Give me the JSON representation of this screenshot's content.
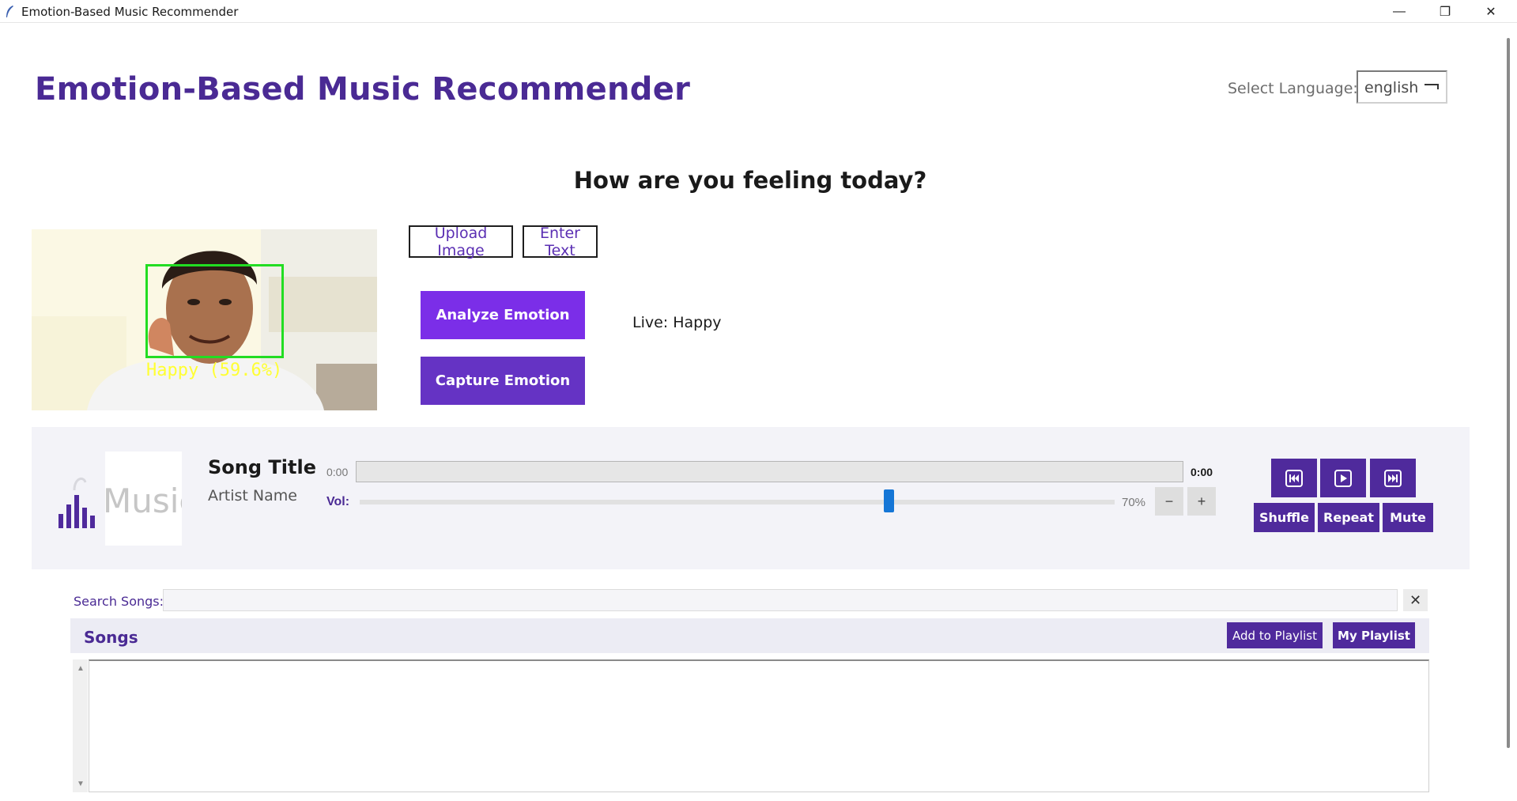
{
  "window": {
    "title": "Emotion-Based Music Recommender",
    "minimize": "—",
    "maximize": "❐",
    "close": "✕"
  },
  "header": {
    "app_title": "Emotion-Based Music Recommender",
    "language_label": "Select Language:",
    "language_value": "english"
  },
  "emotion": {
    "question": "How are you feeling today?",
    "camera_detection_label": "Happy (59.6%)",
    "upload_image_label": "Upload Image",
    "enter_text_label": "Enter Text",
    "analyze_label": "Analyze Emotion",
    "capture_label": "Capture Emotion",
    "live_status": "Live: Happy",
    "accent_color": "#7b2ee8",
    "face_box_color": "#22dd22",
    "detection_text_color": "#ffff33"
  },
  "player": {
    "album_placeholder": "Music",
    "song_title": "Song Title",
    "artist": "Artist Name",
    "time_current": "0:00",
    "time_total": "0:00",
    "progress": 0,
    "volume_label": "Vol:",
    "volume_percent": 70,
    "volume_text": "70%",
    "vol_down": "−",
    "vol_up": "+",
    "controls": {
      "prev_icon": "skip-previous-icon",
      "play_icon": "play-icon",
      "next_icon": "skip-next-icon",
      "shuffle": "Shuffle",
      "repeat": "Repeat",
      "mute": "Mute"
    },
    "brand_color": "#4f2a9c"
  },
  "library": {
    "search_label": "Search Songs:",
    "search_value": "",
    "clear_label": "✕",
    "songs_title": "Songs",
    "add_to_playlist": "Add to Playlist",
    "my_playlist": "My Playlist",
    "songs": []
  }
}
